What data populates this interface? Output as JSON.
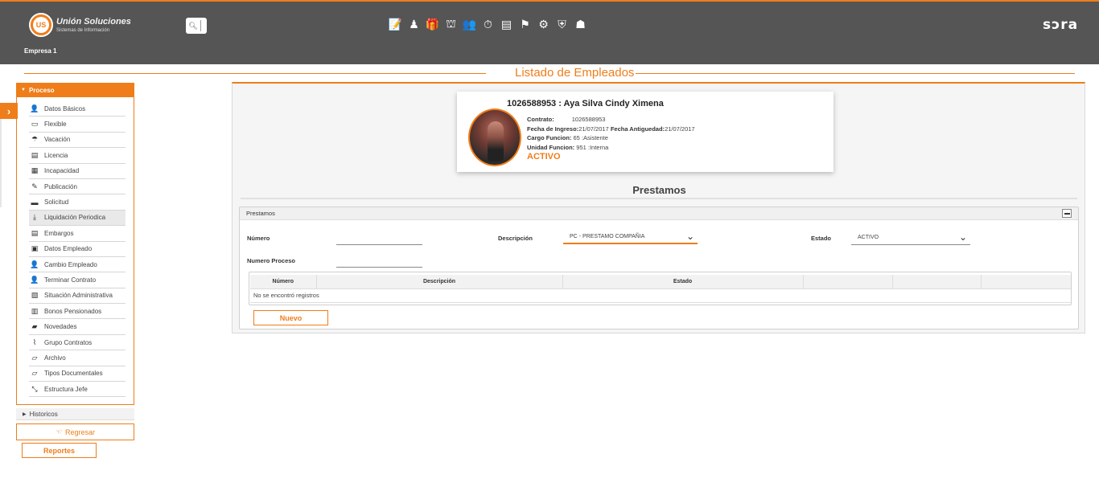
{
  "header": {
    "logo_name": "Unión Soluciones",
    "logo_sub": "Sistemas de Información",
    "logo_mark": "US",
    "company": "Empresa 1",
    "brand": "sɔra",
    "search_icon": "search-icon",
    "modules": [
      {
        "icon": "edit-document-icon",
        "glyph": "📝"
      },
      {
        "icon": "user-gear-icon",
        "glyph": "♟"
      },
      {
        "icon": "gift-icon",
        "glyph": "🎁"
      },
      {
        "icon": "organization-icon",
        "glyph": "⛫"
      },
      {
        "icon": "users-icon",
        "glyph": "👥"
      },
      {
        "icon": "stopwatch-icon",
        "glyph": "⏱"
      },
      {
        "icon": "report-icon",
        "glyph": "▤"
      },
      {
        "icon": "presentation-icon",
        "glyph": "⚑"
      },
      {
        "icon": "network-icon",
        "glyph": "⚙"
      },
      {
        "icon": "shield-user-icon",
        "glyph": "⛨"
      },
      {
        "icon": "meeting-icon",
        "glyph": "☗"
      }
    ]
  },
  "page_title": "Listado de Empleados",
  "sidebar": {
    "section": "Proceso",
    "items": [
      {
        "label": "Datos Básicos",
        "icon": "user-icon",
        "glyph": "👤"
      },
      {
        "label": "Flexible",
        "icon": "money-icon",
        "glyph": "▭"
      },
      {
        "label": "Vacación",
        "icon": "beach-icon",
        "glyph": "☂"
      },
      {
        "label": "Licencia",
        "icon": "document-icon",
        "glyph": "▤"
      },
      {
        "label": "Incapacidad",
        "icon": "medical-icon",
        "glyph": "▦"
      },
      {
        "label": "Publicación",
        "icon": "pencil-icon",
        "glyph": "✎"
      },
      {
        "label": "Solicitud",
        "icon": "request-icon",
        "glyph": "▬"
      },
      {
        "label": "Liquidación Periodica",
        "icon": "download-icon",
        "glyph": "⤓"
      },
      {
        "label": "Embargos",
        "icon": "form-icon",
        "glyph": "▤"
      },
      {
        "label": "Datos Empleado",
        "icon": "id-card-icon",
        "glyph": "▣"
      },
      {
        "label": "Cambio Empleado",
        "icon": "user-change-icon",
        "glyph": "👤"
      },
      {
        "label": "Terminar Contrato",
        "icon": "user-remove-icon",
        "glyph": "👤"
      },
      {
        "label": "Situación Administrativa",
        "icon": "file-icon",
        "glyph": "▧"
      },
      {
        "label": "Bonos Pensionados",
        "icon": "book-icon",
        "glyph": "▥"
      },
      {
        "label": "Novedades",
        "icon": "comment-icon",
        "glyph": "▰"
      },
      {
        "label": "Grupo Contratos",
        "icon": "paperclip-icon",
        "glyph": "⌇"
      },
      {
        "label": "Archivo",
        "icon": "folder-open-icon",
        "glyph": "▱"
      },
      {
        "label": "Tipos Documentales",
        "icon": "folder-open-icon",
        "glyph": "▱"
      },
      {
        "label": "Estructura Jefe",
        "icon": "compress-icon",
        "glyph": "⤡"
      }
    ],
    "historicos": "Historicos",
    "regresar": "Regresar",
    "reportes": "Reportes"
  },
  "employee": {
    "title": "1026588953 : Aya Silva Cindy Ximena",
    "contrato_label": "Contrato:",
    "contrato": "1026588953",
    "fecha_ingreso_label": "Fecha de Ingreso:",
    "fecha_ingreso": "21/07/2017",
    "fecha_antiguedad_label": "Fecha Antiguedad:",
    "fecha_antiguedad": "21/07/2017",
    "cargo_label": "Cargo Funcion:",
    "cargo": "65 :Asistente",
    "unidad_label": "Unidad Funcion:",
    "unidad": "951 :Interna",
    "status": "ACTIVO"
  },
  "section_title": "Prestamos",
  "form": {
    "panel_title": "Prestamos",
    "numero_label": "Número",
    "numero_value": "",
    "numero_proceso_label": "Numero Proceso",
    "numero_proceso_value": "",
    "descripcion_label": "Descripción",
    "descripcion_value": "PC - PRESTAMO COMPAÑIA",
    "estado_label": "Estado",
    "estado_value": "ACTIVO"
  },
  "grid": {
    "columns": [
      "Número",
      "Descripción",
      "Estado",
      "",
      "",
      ""
    ],
    "empty_message": "No se encontró registros"
  },
  "nuevo_button": "Nuevo",
  "colors": {
    "accent": "#ef7d1a",
    "header_bg": "#555555"
  }
}
